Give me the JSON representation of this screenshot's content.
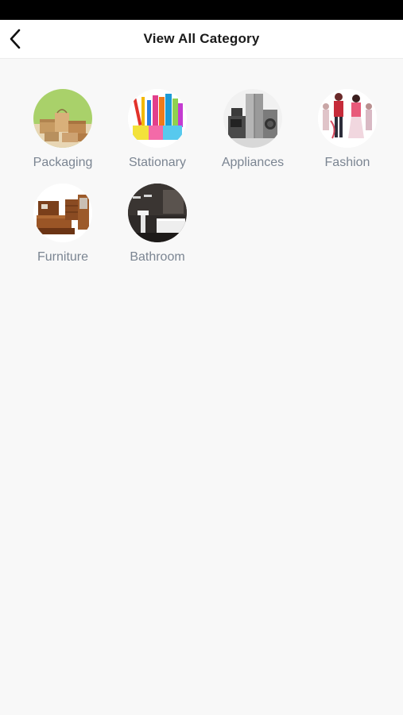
{
  "header": {
    "title": "View All Category",
    "back_icon": "chevron-left-icon"
  },
  "categories": [
    {
      "label": "Packaging",
      "icon": "packaging-boxes-image"
    },
    {
      "label": "Stationary",
      "icon": "stationery-supplies-image"
    },
    {
      "label": "Appliances",
      "icon": "home-appliances-image"
    },
    {
      "label": "Fashion",
      "icon": "fashion-models-image"
    },
    {
      "label": "Furniture",
      "icon": "bedroom-furniture-image"
    },
    {
      "label": "Bathroom",
      "icon": "bathroom-interior-image"
    }
  ],
  "colors": {
    "status_bar": "#000000",
    "header_bg": "#ffffff",
    "page_bg": "#f8f8f8",
    "label_text": "#7b8592",
    "title_text": "#1a1a1a"
  }
}
